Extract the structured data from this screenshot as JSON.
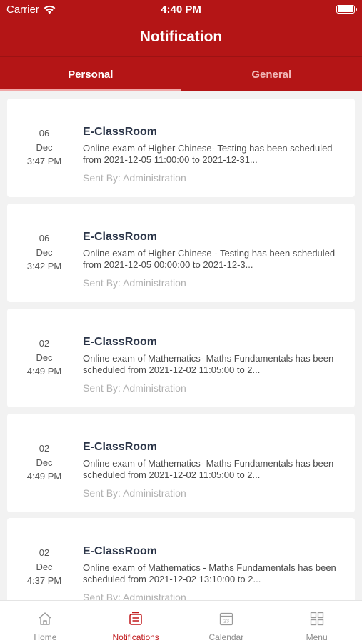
{
  "status_bar": {
    "carrier": "Carrier",
    "time": "4:40 PM"
  },
  "header": {
    "title": "Notification"
  },
  "tabs": [
    {
      "label": "Personal",
      "active": true
    },
    {
      "label": "General",
      "active": false
    }
  ],
  "notifications": [
    {
      "day": "06",
      "month": "Dec",
      "time": "3:47 PM",
      "title": "E-ClassRoom",
      "body": "Online exam of Higher Chinese- Testing has been scheduled from  2021-12-05 11:00:00 to 2021-12-31...",
      "sender": "Sent By: Administration"
    },
    {
      "day": "06",
      "month": "Dec",
      "time": "3:42 PM",
      "title": "E-ClassRoom",
      "body": "Online exam of Higher Chinese - Testing has been scheduled from  2021-12-05 00:00:00 to 2021-12-3...",
      "sender": "Sent By: Administration"
    },
    {
      "day": "02",
      "month": "Dec",
      "time": "4:49 PM",
      "title": "E-ClassRoom",
      "body": "Online exam of Mathematics- Maths Fundamentals has been scheduled from  2021-12-02 11:05:00 to 2...",
      "sender": "Sent By: Administration"
    },
    {
      "day": "02",
      "month": "Dec",
      "time": "4:49 PM",
      "title": "E-ClassRoom",
      "body": "Online exam of Mathematics- Maths Fundamentals has been scheduled from  2021-12-02 11:05:00 to 2...",
      "sender": "Sent By: Administration"
    },
    {
      "day": "02",
      "month": "Dec",
      "time": "4:37 PM",
      "title": "E-ClassRoom",
      "body": "Online exam of Mathematics - Maths Fundamentals has been scheduled from  2021-12-02 13:10:00 to 2...",
      "sender": "Sent By: Administration"
    }
  ],
  "bottom_nav": [
    {
      "label": "Home",
      "icon": "home-icon"
    },
    {
      "label": "Notifications",
      "icon": "notifications-icon",
      "active": true
    },
    {
      "label": "Calendar",
      "icon": "calendar-icon",
      "calendar_day": "23"
    },
    {
      "label": "Menu",
      "icon": "menu-grid-icon"
    }
  ],
  "colors": {
    "brand": "#b41516",
    "active_tab_underline": "#f0a6a6",
    "nav_active": "#c0171a",
    "nav_inactive": "#8c8c8c"
  }
}
